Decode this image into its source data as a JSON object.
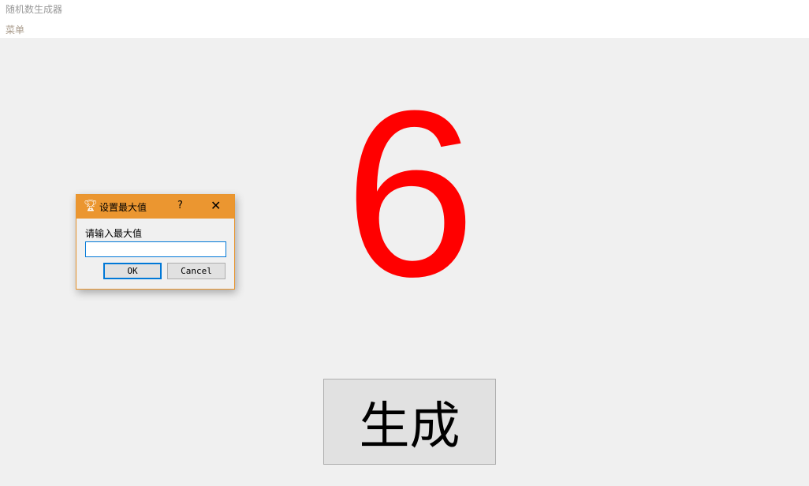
{
  "window": {
    "title": "随机数生成器",
    "menu": "菜单"
  },
  "main": {
    "number": "6",
    "number_color": "#ff0000",
    "generate_label": "生成"
  },
  "dialog": {
    "title": "设置最大值",
    "help": "?",
    "close": "✕",
    "icon": "trophy-icon",
    "prompt": "请输入最大值",
    "input_value": "",
    "ok_label": "OK",
    "cancel_label": "Cancel",
    "accent": "#eb9630"
  }
}
